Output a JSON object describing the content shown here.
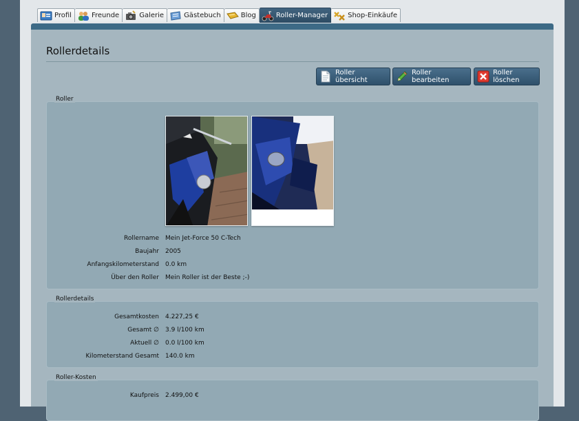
{
  "tabs": [
    {
      "label": "Profil",
      "icon": "profile-card-icon"
    },
    {
      "label": "Freunde",
      "icon": "friends-icon"
    },
    {
      "label": "Galerie",
      "icon": "gallery-icon"
    },
    {
      "label": "Gästebuch",
      "icon": "guestbook-icon"
    },
    {
      "label": "Blog",
      "icon": "blog-icon"
    },
    {
      "label": "Roller-Manager",
      "icon": "scooter-icon"
    },
    {
      "label": "Shop-Einkäufe",
      "icon": "shop-icon"
    }
  ],
  "page": {
    "title": "Rollerdetails"
  },
  "toolbar": {
    "overview_label": "Roller übersicht",
    "edit_label": "Roller bearbeiten",
    "delete_label": "Roller löschen"
  },
  "roller": {
    "legend": "Roller",
    "fields": [
      {
        "label": "Rollername",
        "value": "Mein Jet-Force 50 C-Tech"
      },
      {
        "label": "Baujahr",
        "value": "2005"
      },
      {
        "label": "Anfangskilometerstand",
        "value": "0.0 km"
      },
      {
        "label": "Über den Roller",
        "value": "Mein Roller ist der Beste ;-)"
      }
    ]
  },
  "details": {
    "legend": "Rollerdetails",
    "fields": [
      {
        "label": "Gesamtkosten",
        "value": "4.227,25 €"
      },
      {
        "label": "Gesamt ∅",
        "value": "3.9 l/100 km"
      },
      {
        "label": "Aktuell ∅",
        "value": "0.0 l/100 km"
      },
      {
        "label": "Kilometerstand Gesamt",
        "value": "140.0 km"
      }
    ]
  },
  "costs": {
    "legend": "Roller-Kosten",
    "fields": [
      {
        "label": "Kaufpreis",
        "value": "2.499,00 €"
      }
    ]
  },
  "colors": {
    "active_tab": "#2d4b63",
    "panel": "#a5b6bf",
    "fieldset": "#92a9b4"
  }
}
